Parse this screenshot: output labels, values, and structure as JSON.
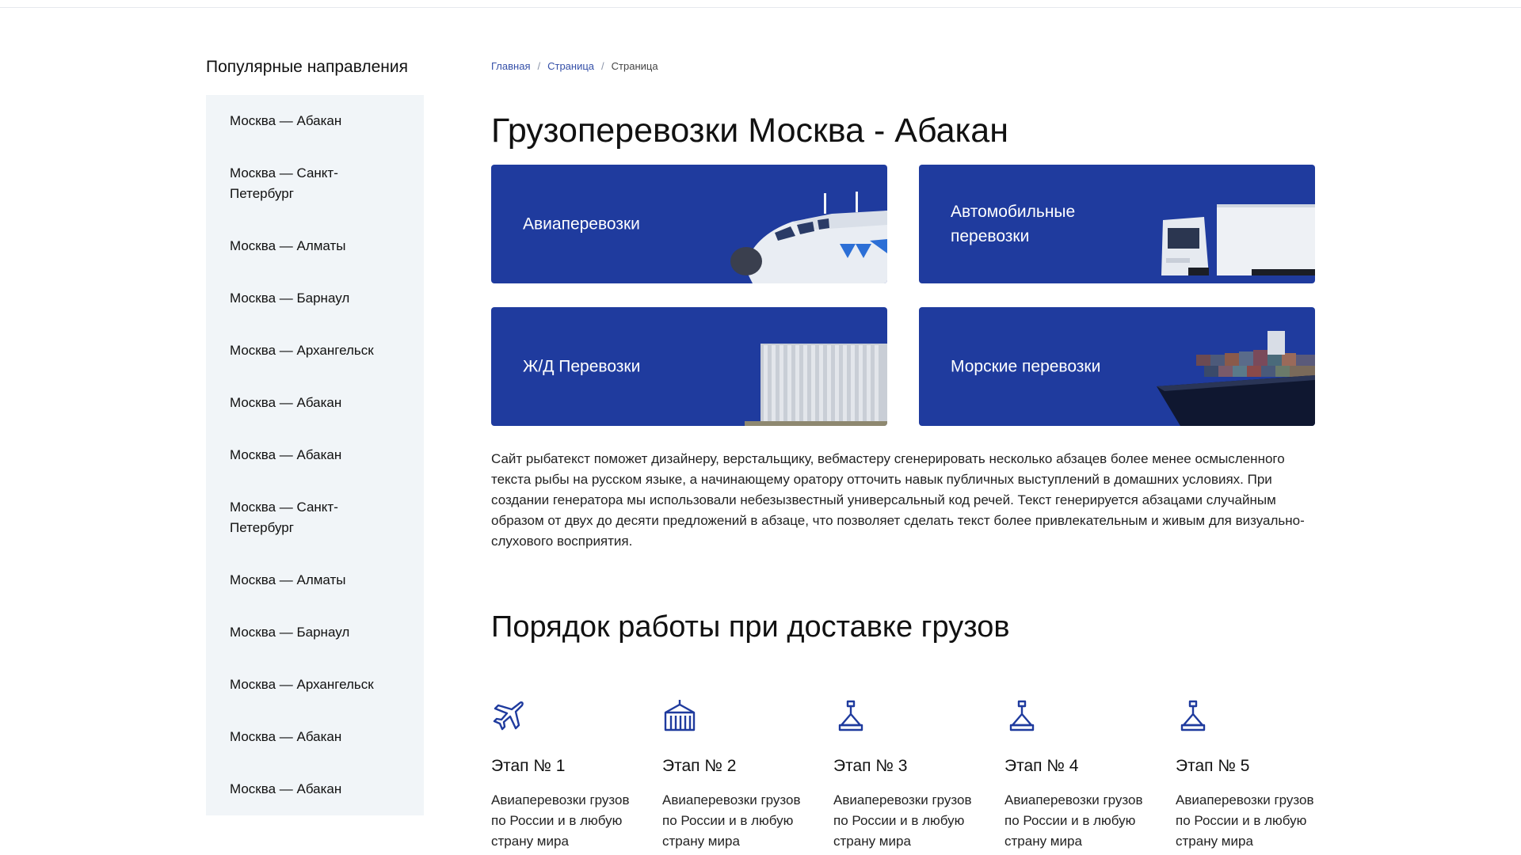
{
  "sidebar": {
    "title": "Популярные направления",
    "items": [
      {
        "label": "Москва — Абакан"
      },
      {
        "label": "Москва — Санкт-Петербург"
      },
      {
        "label": "Москва — Алматы"
      },
      {
        "label": "Москва — Барнаул"
      },
      {
        "label": "Москва — Архангельск"
      },
      {
        "label": "Москва — Абакан"
      },
      {
        "label": "Москва — Абакан"
      },
      {
        "label": "Москва — Санкт-Петербург"
      },
      {
        "label": "Москва — Алматы"
      },
      {
        "label": "Москва — Барнаул"
      },
      {
        "label": "Москва — Архангельск"
      },
      {
        "label": "Москва — Абакан"
      },
      {
        "label": "Москва — Абакан"
      }
    ]
  },
  "breadcrumb": {
    "items": [
      "Главная",
      "Страница",
      "Страница"
    ],
    "separator": "/"
  },
  "page": {
    "title": "Грузоперевозки Москва - Абакан"
  },
  "services": [
    {
      "label": "Авиаперевозки",
      "icon": "airplane-illustration"
    },
    {
      "label": "Автомобильные перевозки",
      "icon": "truck-illustration"
    },
    {
      "label": "Ж/Д Перевозки",
      "icon": "container-illustration"
    },
    {
      "label": "Морские перевозки",
      "icon": "ship-illustration"
    }
  ],
  "intro_text": "Сайт рыбатекст поможет дизайнеру, верстальщику, вебмастеру сгенерировать несколько абзацев более менее осмысленного текста рыбы на русском языке, а начинающему оратору отточить навык публичных выступлений в домашних условиях. При создании генератора мы использовали небезызвестный универсальный код речей. Текст генерируется абзацами случайным образом от двух до десяти предложений в абзаце, что позволяет сделать текст более привлекательным и живым для визуально-слухового восприятия.",
  "process": {
    "title": "Порядок работы при доставке грузов",
    "steps": [
      {
        "title": "Этап № 1",
        "text": "Авиаперевозки грузов по России и в любую страну мира",
        "icon": "airplane-icon"
      },
      {
        "title": "Этап № 2",
        "text": "Авиаперевозки грузов по России и в любую страну мира",
        "icon": "warehouse-icon"
      },
      {
        "title": "Этап № 3",
        "text": "Авиаперевозки грузов по России и в любую страну мира",
        "icon": "crane-hook-icon"
      },
      {
        "title": "Этап № 4",
        "text": "Авиаперевозки грузов по России и в любую страну мира",
        "icon": "crane-hook-icon"
      },
      {
        "title": "Этап № 5",
        "text": "Авиаперевозки грузов по России и в любую страну мира",
        "icon": "crane-hook-icon"
      }
    ]
  },
  "colors": {
    "brand_blue": "#1f3b9e",
    "sidebar_bg": "#f1f5f8",
    "link": "#3550a8"
  }
}
